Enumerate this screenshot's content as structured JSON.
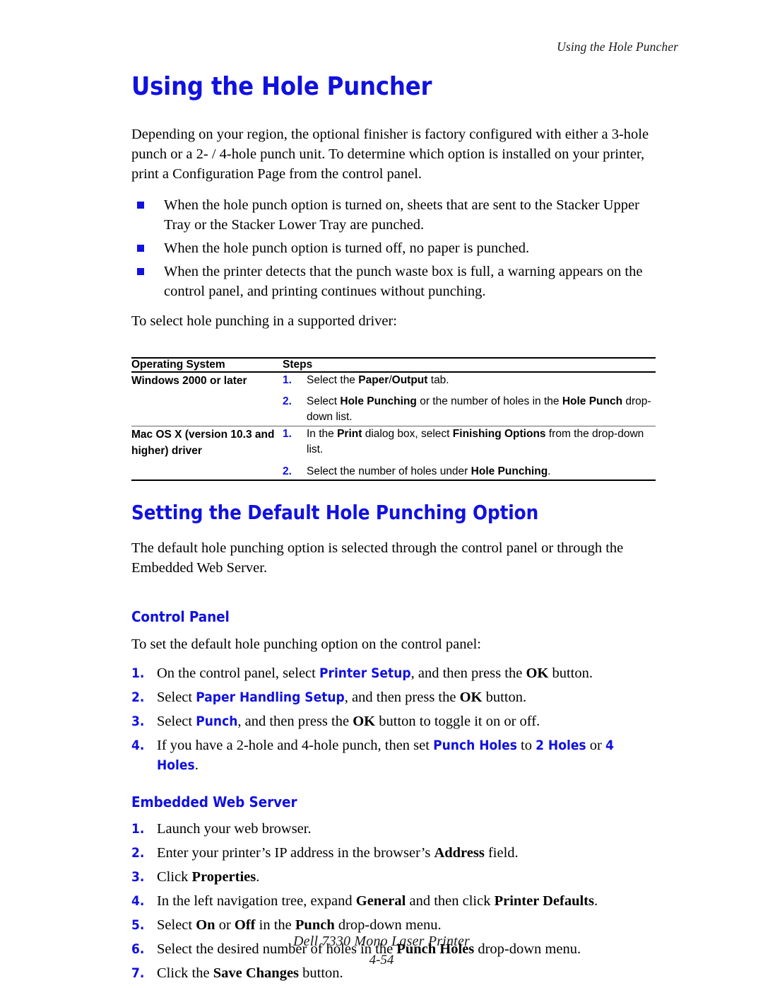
{
  "header": {
    "running_title": "Using the Hole Puncher"
  },
  "colors": {
    "heading_blue": "#1111e0",
    "body_black": "#000000"
  },
  "main": {
    "title": "Using the Hole Puncher",
    "intro": "Depending on your region, the optional finisher is factory configured with either a 3-hole punch or a 2- / 4-hole punch unit. To determine which option is installed on your printer, print a Configuration Page from the control panel.",
    "bullets": [
      "When the hole punch option is turned on, sheets that are sent to the Stacker Upper Tray or the Stacker Lower Tray are punched.",
      "When the hole punch option is turned off, no paper is punched.",
      "When the printer detects that the punch waste box is full, a warning appears on the control panel, and printing continues without punching."
    ],
    "driver_lead_in": "To select hole punching in a supported driver:"
  },
  "table": {
    "columns": [
      "Operating System",
      "Steps"
    ],
    "rows": [
      {
        "os": "Windows 2000 or later",
        "steps": [
          {
            "num": "1.",
            "parts": [
              {
                "t": "Select the ",
                "b": false
              },
              {
                "t": "Paper",
                "b": true
              },
              {
                "t": "/",
                "b": false
              },
              {
                "t": "Output",
                "b": true
              },
              {
                "t": " tab.",
                "b": false
              }
            ]
          },
          {
            "num": "2.",
            "parts": [
              {
                "t": "Select ",
                "b": false
              },
              {
                "t": "Hole Punching",
                "b": true
              },
              {
                "t": " or the number of holes in the ",
                "b": false
              },
              {
                "t": "Hole Punch",
                "b": true
              },
              {
                "t": " drop-down list.",
                "b": false
              }
            ]
          }
        ]
      },
      {
        "os": "Mac OS X (version 10.3 and higher) driver",
        "steps": [
          {
            "num": "1.",
            "parts": [
              {
                "t": "In the ",
                "b": false
              },
              {
                "t": "Print",
                "b": true
              },
              {
                "t": " dialog box, select ",
                "b": false
              },
              {
                "t": "Finishing Options",
                "b": true
              },
              {
                "t": " from the drop-down list.",
                "b": false
              }
            ]
          },
          {
            "num": "2.",
            "parts": [
              {
                "t": "Select the number of holes under ",
                "b": false
              },
              {
                "t": "Hole Punching",
                "b": true
              },
              {
                "t": ".",
                "b": false
              }
            ]
          }
        ]
      }
    ]
  },
  "section_default": {
    "title": "Setting the Default Hole Punching Option",
    "intro": "The default hole punching option is selected through the control panel or through the Embedded Web Server."
  },
  "control_panel": {
    "title": "Control Panel",
    "lead_in": "To set the default hole punching option on the control panel:",
    "steps": [
      {
        "num": "1.",
        "parts": [
          {
            "t": "On the control panel, select ",
            "s": "plain"
          },
          {
            "t": "Printer Setup",
            "s": "ui"
          },
          {
            "t": ", and then press the ",
            "s": "plain"
          },
          {
            "t": "OK",
            "s": "bold"
          },
          {
            "t": " button.",
            "s": "plain"
          }
        ]
      },
      {
        "num": "2.",
        "parts": [
          {
            "t": "Select ",
            "s": "plain"
          },
          {
            "t": "Paper Handling Setup",
            "s": "ui"
          },
          {
            "t": ", and then press the ",
            "s": "plain"
          },
          {
            "t": "OK",
            "s": "bold"
          },
          {
            "t": " button.",
            "s": "plain"
          }
        ]
      },
      {
        "num": "3.",
        "parts": [
          {
            "t": "Select ",
            "s": "plain"
          },
          {
            "t": "Punch",
            "s": "ui"
          },
          {
            "t": ", and then press the ",
            "s": "plain"
          },
          {
            "t": "OK",
            "s": "bold"
          },
          {
            "t": " button to toggle it on or off.",
            "s": "plain"
          }
        ]
      },
      {
        "num": "4.",
        "parts": [
          {
            "t": "If you have a 2-hole and 4-hole punch, then set ",
            "s": "plain"
          },
          {
            "t": "Punch Holes",
            "s": "ui"
          },
          {
            "t": " to ",
            "s": "plain"
          },
          {
            "t": "2 Holes",
            "s": "ui"
          },
          {
            "t": " or ",
            "s": "plain"
          },
          {
            "t": "4 Holes",
            "s": "ui"
          },
          {
            "t": ".",
            "s": "plain"
          }
        ]
      }
    ]
  },
  "web_server": {
    "title": "Embedded Web Server",
    "steps": [
      {
        "num": "1.",
        "parts": [
          {
            "t": "Launch your web browser.",
            "s": "plain"
          }
        ]
      },
      {
        "num": "2.",
        "parts": [
          {
            "t": "Enter your printer’s IP address in the browser’s ",
            "s": "plain"
          },
          {
            "t": "Address",
            "s": "bold"
          },
          {
            "t": " field.",
            "s": "plain"
          }
        ]
      },
      {
        "num": "3.",
        "parts": [
          {
            "t": "Click ",
            "s": "plain"
          },
          {
            "t": "Properties",
            "s": "bold"
          },
          {
            "t": ".",
            "s": "plain"
          }
        ]
      },
      {
        "num": "4.",
        "parts": [
          {
            "t": "In the left navigation tree, expand ",
            "s": "plain"
          },
          {
            "t": "General",
            "s": "bold"
          },
          {
            "t": " and then click ",
            "s": "plain"
          },
          {
            "t": "Printer Defaults",
            "s": "bold"
          },
          {
            "t": ".",
            "s": "plain"
          }
        ]
      },
      {
        "num": "5.",
        "parts": [
          {
            "t": "Select ",
            "s": "plain"
          },
          {
            "t": "On",
            "s": "bold"
          },
          {
            "t": " or ",
            "s": "plain"
          },
          {
            "t": "Off",
            "s": "bold"
          },
          {
            "t": " in the ",
            "s": "plain"
          },
          {
            "t": "Punch",
            "s": "bold"
          },
          {
            "t": " drop-down menu.",
            "s": "plain"
          }
        ]
      },
      {
        "num": "6.",
        "parts": [
          {
            "t": "Select the desired number of holes in the ",
            "s": "plain"
          },
          {
            "t": "Punch Holes",
            "s": "bold"
          },
          {
            "t": " drop-down menu.",
            "s": "plain"
          }
        ]
      },
      {
        "num": "7.",
        "parts": [
          {
            "t": "Click the ",
            "s": "plain"
          },
          {
            "t": "Save Changes",
            "s": "bold"
          },
          {
            "t": " button.",
            "s": "plain"
          }
        ]
      }
    ]
  },
  "footer": {
    "product": "Dell 7330 Mono Laser Printer",
    "page_number": "4-54"
  }
}
